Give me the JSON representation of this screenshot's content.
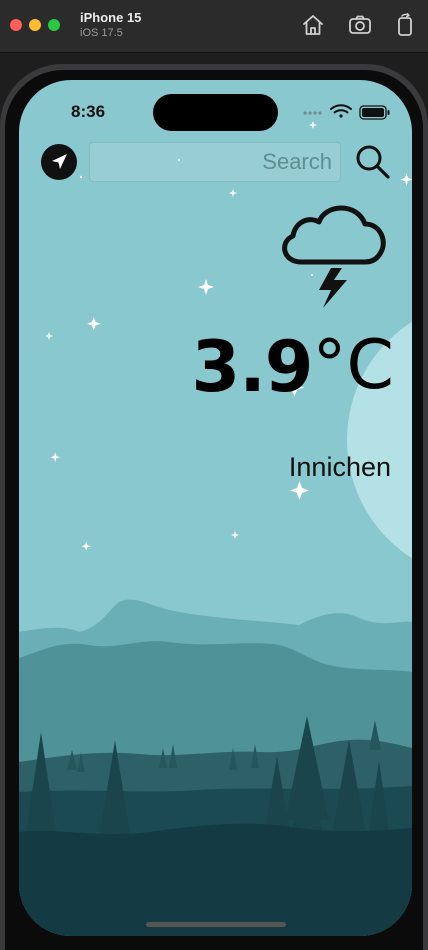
{
  "simulator": {
    "device_name": "iPhone 15",
    "os_version": "iOS 17.5",
    "toolbar_icons": [
      "home-icon",
      "screenshot-icon",
      "rotate-icon"
    ]
  },
  "status_bar": {
    "time": "8:36",
    "icons": [
      "signal-dots-icon",
      "wifi-icon",
      "battery-icon"
    ]
  },
  "search": {
    "placeholder": "Search",
    "value": ""
  },
  "weather": {
    "condition_icon": "cloud-lightning-icon",
    "temperature": "3.9",
    "unit": "°C",
    "city": "Innichen"
  },
  "theme": {
    "sky": "#88c8ce",
    "mountain_far": "#6aafb6",
    "mountain_mid": "#4f9399",
    "hills_dark": "#2d6167",
    "forest": "#1c4a52",
    "ground": "#143b43",
    "moon": "#b3e1e6"
  }
}
